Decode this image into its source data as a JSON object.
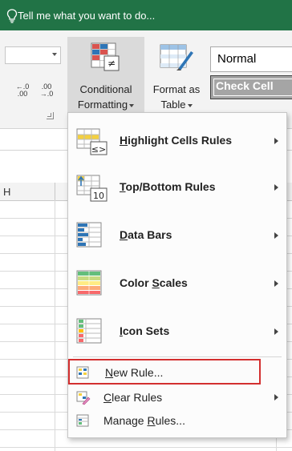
{
  "tellme": {
    "text": "Tell me what you want to do...",
    "icon": "lightbulb-icon"
  },
  "ribbon": {
    "number_format": {
      "value": ""
    },
    "decrease_decimal": {
      "top": "←.0",
      "bottom": ".00"
    },
    "increase_decimal": {
      "top": ".00",
      "bottom": "→.0"
    },
    "conditional_formatting": {
      "line1": "Conditional",
      "line2": "Formatting"
    },
    "format_as_table": {
      "line1": "Format as",
      "line2": "Table"
    },
    "cell_styles": {
      "normal": "Normal",
      "check_cell": "Check Cell"
    }
  },
  "sheet": {
    "column_header": "H"
  },
  "menu": {
    "items": [
      {
        "label": "Highlight Cells Rules",
        "accel": "H",
        "icon": "highlight-cells-icon",
        "submenu": true
      },
      {
        "label": "Top/Bottom Rules",
        "accel": "T",
        "icon": "top-bottom-icon",
        "submenu": true
      },
      {
        "label": "Data Bars",
        "accel": "D",
        "icon": "data-bars-icon",
        "submenu": true
      },
      {
        "label": "Color Scales",
        "accel": "S",
        "icon": "color-scales-icon",
        "submenu": true
      },
      {
        "label": "Icon Sets",
        "accel": "I",
        "icon": "icon-sets-icon",
        "submenu": true
      }
    ],
    "small_items": [
      {
        "label": "New Rule...",
        "accel": "N",
        "icon": "new-rule-icon",
        "submenu": false,
        "highlighted": true
      },
      {
        "label": "Clear Rules",
        "accel": "C",
        "icon": "clear-rules-icon",
        "submenu": true
      },
      {
        "label": "Manage Rules...",
        "accel": "R",
        "icon": "manage-rules-icon",
        "submenu": false
      }
    ]
  },
  "colors": {
    "title_bar": "#217346",
    "highlight_border": "#d32f2f",
    "ribbon_bg": "#f3f3f3"
  }
}
